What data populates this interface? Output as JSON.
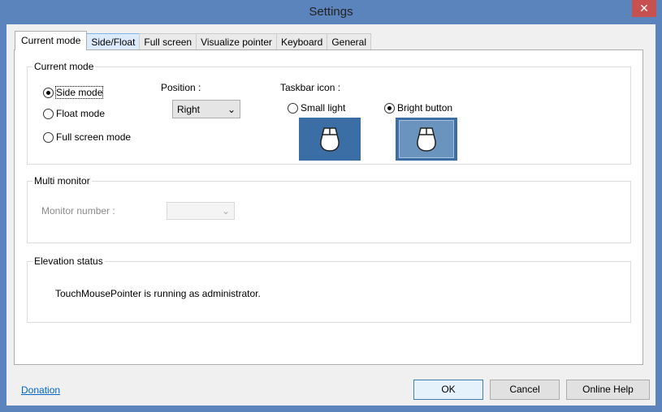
{
  "window": {
    "title": "Settings",
    "close": "✕"
  },
  "tabs": [
    "Current mode",
    "Side/Float",
    "Full screen",
    "Visualize pointer",
    "Keyboard",
    "General"
  ],
  "current_mode": {
    "group_label": "Current mode",
    "modes": [
      {
        "label": "Side mode",
        "checked": true
      },
      {
        "label": "Float mode",
        "checked": false
      },
      {
        "label": "Full screen mode",
        "checked": false
      }
    ],
    "position_label": "Position :",
    "position_value": "Right",
    "taskbar_label": "Taskbar icon :",
    "taskbar_options": [
      {
        "label": "Small light",
        "checked": false
      },
      {
        "label": "Bright button",
        "checked": true
      }
    ]
  },
  "multi_monitor": {
    "group_label": "Multi monitor",
    "monitor_label": "Monitor number :",
    "monitor_value": ""
  },
  "elevation": {
    "group_label": "Elevation status",
    "text": "TouchMousePointer is running as administrator."
  },
  "footer": {
    "donation": "Donation",
    "ok": "OK",
    "cancel": "Cancel",
    "help": "Online Help"
  },
  "colors": {
    "titlebar": "#5a84bb",
    "close": "#c75050",
    "link": "#0066cc"
  }
}
